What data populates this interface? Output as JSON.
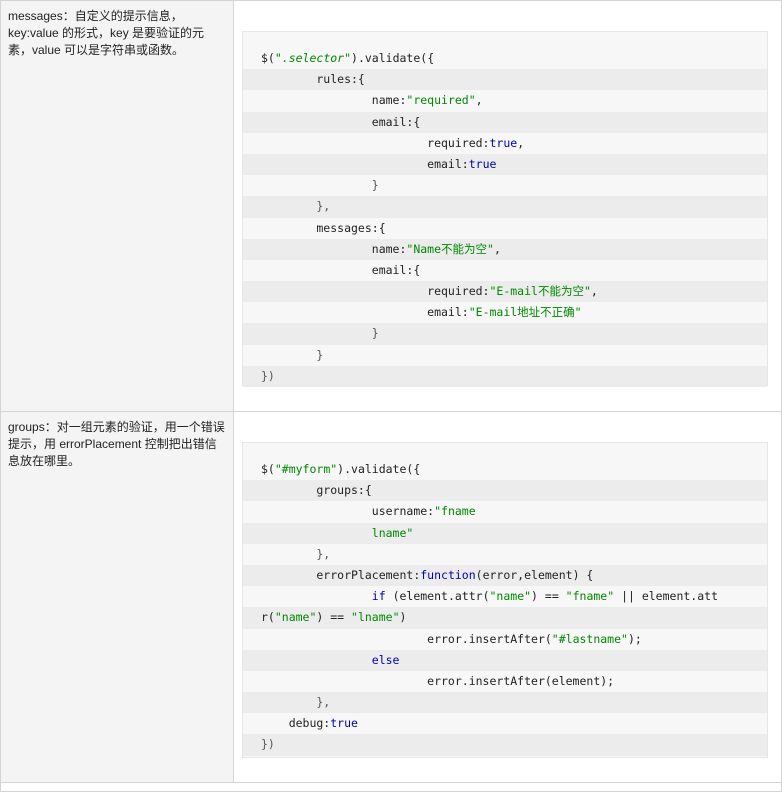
{
  "rows": [
    {
      "description": "messages：自定义的提示信息，key:value 的形式，key 是要验证的元素，value 可以是字符串或函数。",
      "code_lines": [
        [
          {
            "t": "$(",
            "c": "k"
          },
          {
            "t": "\".selector\"",
            "c": "s i"
          },
          {
            "t": ").validate({",
            "c": "k"
          }
        ],
        [
          {
            "t": "        rules:{",
            "c": "k"
          }
        ],
        [
          {
            "t": "                name:",
            "c": "k"
          },
          {
            "t": "\"required\"",
            "c": "s"
          },
          {
            "t": ",",
            "c": "k"
          }
        ],
        [
          {
            "t": "                email:{",
            "c": "k"
          }
        ],
        [
          {
            "t": "                        required:",
            "c": "k"
          },
          {
            "t": "true",
            "c": "b"
          },
          {
            "t": ",",
            "c": "k"
          }
        ],
        [
          {
            "t": "                        email:",
            "c": "k"
          },
          {
            "t": "true",
            "c": "b"
          }
        ],
        [
          {
            "t": "                }",
            "c": "p"
          }
        ],
        [
          {
            "t": "        },",
            "c": "p"
          }
        ],
        [
          {
            "t": "        messages:{",
            "c": "k"
          }
        ],
        [
          {
            "t": "                name:",
            "c": "k"
          },
          {
            "t": "\"Name不能为空\"",
            "c": "s"
          },
          {
            "t": ",",
            "c": "k"
          }
        ],
        [
          {
            "t": "                email:{",
            "c": "k"
          }
        ],
        [
          {
            "t": "                        required:",
            "c": "k"
          },
          {
            "t": "\"E-mail不能为空\"",
            "c": "s"
          },
          {
            "t": ",",
            "c": "k"
          }
        ],
        [
          {
            "t": "                        email:",
            "c": "k"
          },
          {
            "t": "\"E-mail地址不正确\"",
            "c": "s"
          }
        ],
        [
          {
            "t": "                }",
            "c": "p"
          }
        ],
        [
          {
            "t": "        }",
            "c": "p"
          }
        ],
        [
          {
            "t": "})",
            "c": "p"
          }
        ]
      ]
    },
    {
      "description": "groups：对一组元素的验证，用一个错误提示，用 errorPlacement 控制把出错信息放在哪里。",
      "code_lines": [
        [
          {
            "t": "$(",
            "c": "k"
          },
          {
            "t": "\"#myform\"",
            "c": "s"
          },
          {
            "t": ").validate({",
            "c": "k"
          }
        ],
        [
          {
            "t": "        groups:{",
            "c": "k"
          }
        ],
        [
          {
            "t": "                username:",
            "c": "k"
          },
          {
            "t": "\"fname",
            "c": "s"
          }
        ],
        [
          {
            "t": "                lname\"",
            "c": "s"
          }
        ],
        [
          {
            "t": "        },",
            "c": "p"
          }
        ],
        [
          {
            "t": "        errorPlacement:",
            "c": "k"
          },
          {
            "t": "function",
            "c": "b"
          },
          {
            "t": "(error,element) {",
            "c": "k"
          }
        ],
        [
          {
            "t": "                ",
            "c": "k"
          },
          {
            "t": "if",
            "c": "b"
          },
          {
            "t": " (element.attr(",
            "c": "k"
          },
          {
            "t": "\"name\"",
            "c": "s"
          },
          {
            "t": ") == ",
            "c": "k"
          },
          {
            "t": "\"fname\"",
            "c": "s"
          },
          {
            "t": " || element.att",
            "c": "k"
          }
        ],
        [
          {
            "t": "r(",
            "c": "k"
          },
          {
            "t": "\"name\"",
            "c": "s"
          },
          {
            "t": ") == ",
            "c": "k"
          },
          {
            "t": "\"lname\"",
            "c": "s"
          },
          {
            "t": ")",
            "c": "k"
          }
        ],
        [
          {
            "t": "                        error.insertAfter(",
            "c": "k"
          },
          {
            "t": "\"#lastname\"",
            "c": "s"
          },
          {
            "t": ");",
            "c": "k"
          }
        ],
        [
          {
            "t": "                ",
            "c": "k"
          },
          {
            "t": "else",
            "c": "b"
          }
        ],
        [
          {
            "t": "                        error.insertAfter(element);",
            "c": "k"
          }
        ],
        [
          {
            "t": "        },",
            "c": "p"
          }
        ],
        [
          {
            "t": "    debug:",
            "c": "k"
          },
          {
            "t": "true",
            "c": "b"
          }
        ],
        [
          {
            "t": "})",
            "c": "p"
          }
        ]
      ]
    }
  ],
  "colors": {
    "string": "#008800",
    "keyword": "#0000b0",
    "text": "#222222",
    "desc_bg": "#f4f4f4",
    "code_bg": "#f7f7f7",
    "code_alt_bg": "#ececec",
    "border": "#d4d4d4"
  }
}
